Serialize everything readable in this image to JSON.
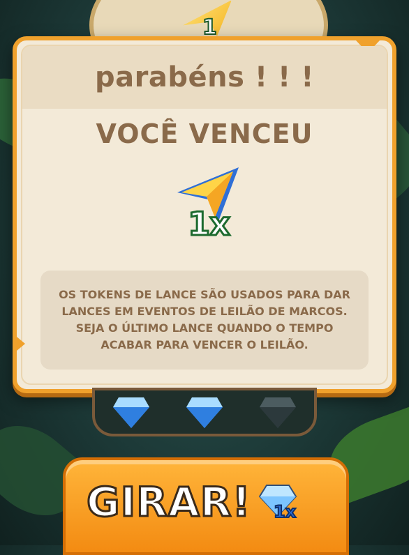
{
  "modal": {
    "title": "parabéns ! ! !",
    "subtitle": "VOCÊ VENCEU",
    "reward": {
      "icon": "bid-token-arrow-icon",
      "quantity": "1x"
    },
    "description": "OS TOKENS DE LANCE SÃO USADOS PARA DAR LANCES EM EVENTOS DE LEILÃO DE MARCOS. SEJA O ÚLTIMO LANCE QUANDO O TEMPO ACABAR PARA VENCER O LEILÃO."
  },
  "background_wheel": {
    "visible_number": "1"
  },
  "gems": [
    {
      "icon": "blue-diamond-icon",
      "state": "filled"
    },
    {
      "icon": "blue-diamond-icon",
      "state": "filled"
    },
    {
      "icon": "blue-diamond-icon",
      "state": "empty"
    }
  ],
  "spin_button": {
    "label": "GIRAR!",
    "cost_icon": "diamond-icon",
    "cost": "1x"
  },
  "colors": {
    "modal_border": "#f0a12c",
    "text_brown": "#8a6a4a",
    "button_orange": "#f38b12"
  }
}
